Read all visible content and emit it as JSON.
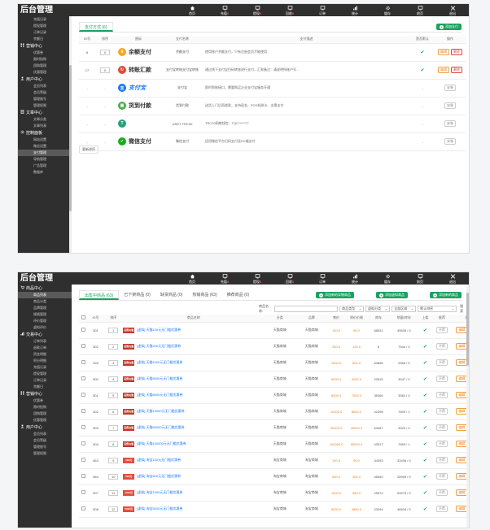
{
  "app_title": "后台管理",
  "nav": [
    {
      "label": "首页",
      "icon": "home-icon",
      "badge": ""
    },
    {
      "label": "充值",
      "icon": "monitor-icon",
      "badge": "0"
    },
    {
      "label": "提现",
      "icon": "monitor-icon",
      "badge": "0"
    },
    {
      "label": "回收",
      "icon": "monitor-icon",
      "badge": "0"
    },
    {
      "label": "订单",
      "icon": "monitor-icon",
      "badge": ""
    },
    {
      "label": "统计",
      "icon": "bar-chart-icon",
      "badge": ""
    },
    {
      "label": "缓存",
      "icon": "gear-icon",
      "badge": ""
    },
    {
      "label": "前页",
      "icon": "monitor-icon",
      "badge": ""
    },
    {
      "label": "退出",
      "icon": "close-icon",
      "badge": ""
    }
  ],
  "screen1": {
    "sidebar": [
      {
        "type": "item",
        "label": "充值记录"
      },
      {
        "type": "item",
        "label": "提现管理"
      },
      {
        "type": "item",
        "label": "订单记录"
      },
      {
        "type": "item",
        "label": "余额日"
      },
      {
        "type": "group",
        "label": "营销中心",
        "icon": "grid-icon"
      },
      {
        "type": "item",
        "label": "优惠券"
      },
      {
        "type": "item",
        "label": "限时抢购"
      },
      {
        "type": "item",
        "label": "团购管理"
      },
      {
        "type": "item",
        "label": "优惠管理"
      },
      {
        "type": "group",
        "label": "用户中心",
        "icon": "user-icon"
      },
      {
        "type": "item",
        "label": "会员列表"
      },
      {
        "type": "item",
        "label": "会员等级"
      },
      {
        "type": "item",
        "label": "管理账号"
      },
      {
        "type": "item",
        "label": "管理权限"
      },
      {
        "type": "group",
        "label": "文章中心",
        "icon": "doc-icon"
      },
      {
        "type": "item",
        "label": "文章分类"
      },
      {
        "type": "item",
        "label": "文章列表"
      },
      {
        "type": "group",
        "label": "控制面板",
        "icon": "gear-icon"
      },
      {
        "type": "item",
        "label": "网站设置"
      },
      {
        "type": "item",
        "label": "微信设置"
      },
      {
        "type": "item",
        "label": "支付管理",
        "active": true
      },
      {
        "type": "item",
        "label": "导航管理"
      },
      {
        "type": "item",
        "label": "广告管理"
      },
      {
        "type": "item",
        "label": "数据库"
      }
    ],
    "tab": "支付方式 (6)",
    "add_button": "添加支付",
    "headers": [
      "ID号",
      "排序",
      "图标",
      "支付名称",
      "支付描述",
      "是否默认",
      "操作"
    ],
    "rows": [
      {
        "id": "8",
        "sort": "0",
        "logo_color": "#f5a623",
        "logo_char": "¥",
        "name": "余额支付",
        "name_style": "",
        "pay_name": "余额支付",
        "desc": "使用账户余额支付，只有注册会员才能使用",
        "default": "✔",
        "ops": [
          "编辑",
          "删除"
        ],
        "op_style": "orange"
      },
      {
        "id": "17",
        "sort": "0",
        "logo_color": "#e04a3a",
        "logo_char": "↻",
        "name": "转账汇款",
        "name_style": "",
        "pay_name": "支付宝转账支付宝转账",
        "desc": "通过线下支付宝扫码转账进行支付，汇款备注：请说明所账户号…",
        "default": "✔",
        "ops": [
          "编辑",
          "删除"
        ],
        "op_style": "orange"
      },
      {
        "id": "-",
        "sort": "-",
        "logo_color": "#1677ff",
        "logo_char": "支",
        "name": "支付宝",
        "name_style": "alipay",
        "pay_name": "支付宝",
        "desc": "即时到账接口，需要购买企业支付宝服务开通",
        "default": "-",
        "ops": [
          "安装"
        ],
        "op_style": "grey"
      },
      {
        "id": "-",
        "sort": "-",
        "logo_color": "#4caf50",
        "logo_char": "▣",
        "name": "货到付款",
        "name_style": "",
        "pay_name": "货到付款",
        "desc": "送货上门后再收款，支持现金、POS机刷卡、支票支付",
        "default": "-",
        "ops": [
          "安装"
        ],
        "op_style": "grey"
      },
      {
        "id": "-",
        "sort": "-",
        "logo_color": "#26a17b",
        "logo_char": "T",
        "name": "",
        "name_style": "",
        "pay_name": "USDT-TRC20",
        "desc": "TRC20网络钱包：TQC*****T7",
        "default": "-",
        "ops": [
          "安装"
        ],
        "op_style": "grey"
      },
      {
        "id": "-",
        "sort": "-",
        "logo_color": "#1aad19",
        "logo_char": "✓",
        "name": "微信支付",
        "name_style": "",
        "pay_name": "微信支付",
        "desc": "适用微信平台扫码支付及PC端支付",
        "default": "-",
        "ops": [
          "安装"
        ],
        "op_style": "grey"
      }
    ],
    "sort_button": "更新排序"
  },
  "screen2": {
    "sidebar": [
      {
        "type": "group",
        "label": "商品中心",
        "icon": "cart-icon"
      },
      {
        "type": "item",
        "label": "商品列表",
        "active": true
      },
      {
        "type": "item",
        "label": "商品分类"
      },
      {
        "type": "item",
        "label": "品牌管理"
      },
      {
        "type": "item",
        "label": "规格管理"
      },
      {
        "type": "item",
        "label": "评价管理"
      },
      {
        "type": "item",
        "label": "虚拟评价"
      },
      {
        "type": "group",
        "label": "交易中心",
        "icon": "bar-chart-icon"
      },
      {
        "type": "item",
        "label": "订单列表"
      },
      {
        "type": "item",
        "label": "退款订单"
      },
      {
        "type": "item",
        "label": "资金明细"
      },
      {
        "type": "item",
        "label": "积分明细"
      },
      {
        "type": "item",
        "label": "充值记录"
      },
      {
        "type": "item",
        "label": "提现管理"
      },
      {
        "type": "item",
        "label": "订单记录"
      },
      {
        "type": "item",
        "label": "余额日"
      },
      {
        "type": "group",
        "label": "营销中心",
        "icon": "grid-icon"
      },
      {
        "type": "item",
        "label": "优惠券"
      },
      {
        "type": "item",
        "label": "限时抢购"
      },
      {
        "type": "item",
        "label": "团购管理"
      },
      {
        "type": "item",
        "label": "优惠管理"
      },
      {
        "type": "group",
        "label": "用户中心",
        "icon": "user-icon"
      },
      {
        "type": "item",
        "label": "会员列表"
      },
      {
        "type": "item",
        "label": "会员等级"
      },
      {
        "type": "item",
        "label": "管理账号"
      },
      {
        "type": "item",
        "label": "管理权限"
      }
    ],
    "tabs": [
      "出售中商品 (63)",
      "已下架商品 (0)",
      "缺货商品 (0)",
      "热销商品 (63)",
      "推荐商品 (0)"
    ],
    "action_buttons": [
      "添加新的实物商品",
      "添加虚拟商品",
      "添加新的商品"
    ],
    "filter": {
      "label": "商品名称:",
      "selects": [
        "商品类型",
        "虚拟分类",
        "全部区域",
        "默认排序"
      ],
      "search": "搜索"
    },
    "headers": [
      "",
      "ID号",
      "排序",
      "商品名称",
      "分类",
      "品牌",
      "售价",
      "原价价格",
      "库存",
      "销量/库存",
      "上架",
      "推荐",
      "操作"
    ],
    "rows": [
      {
        "id": "501",
        "sort": "1",
        "img_color": "#c0392b",
        "img_text": "话费充值",
        "name": "[虚拟] 天猫100元无门槛优惠券",
        "cat": "天猫商城",
        "brand": "天猫商城",
        "price": "100.0",
        "orig": "98.0",
        "stock": "68531",
        "sales": "45635 / 0"
      },
      {
        "id": "502",
        "sort": "2",
        "img_color": "#c0392b",
        "img_text": "话费充值",
        "name": "[虚拟] 天猫200元无门槛优惠券",
        "cat": "天猫商城",
        "brand": "天猫商城",
        "price": "300.0",
        "orig": "125.0",
        "stock": "6",
        "sales": "7544 / 0"
      },
      {
        "id": "499",
        "sort": "3",
        "img_color": "#c0392b",
        "img_text": "话费充值",
        "name": "[虚拟] 天猫1000元无门槛优惠券",
        "cat": "天猫商城",
        "brand": "天猫商城",
        "price": "1000.0",
        "orig": "600.0",
        "stock": "64896",
        "sales": "2565 / 0"
      },
      {
        "id": "500",
        "sort": "4",
        "img_color": "#c0392b",
        "img_text": "话费充值",
        "name": "[虚拟] 天猫5000元无门槛优惠券",
        "cat": "天猫商城",
        "brand": "天猫商城",
        "price": "5000.0",
        "orig": "4000.0",
        "stock": "23515",
        "sales": "3547 / 0"
      },
      {
        "id": "501",
        "sort": "5",
        "img_color": "#c0392b",
        "img_text": "话费充值",
        "name": "[虚拟] 天猫8000元无门槛优惠券",
        "cat": "天猫商城",
        "brand": "天猫商城",
        "price": "8000.0",
        "orig": "7500.0",
        "stock": "35366",
        "sales": "3563 / 0"
      },
      {
        "id": "502",
        "sort": "6",
        "img_color": "#c0392b",
        "img_text": "话费充值",
        "name": "[虚拟] 天猫10000元无门槛优惠券",
        "cat": "天猫商城",
        "brand": "天猫商城",
        "price": "10000.0",
        "orig": "8600.0",
        "stock": "42398",
        "sales": "7609 / 1"
      },
      {
        "id": "503",
        "sort": "7",
        "img_color": "#c0392b",
        "img_text": "话费充值",
        "name": "[虚拟] 天猫50000元无门槛优惠券",
        "cat": "天猫商城",
        "brand": "天猫商城",
        "price": "50000.0",
        "orig": "45000.0",
        "stock": "63457",
        "sales": "3520 / 0"
      },
      {
        "id": "504",
        "sort": "8",
        "img_color": "#c0392b",
        "img_text": "话费充值",
        "name": "[虚拟] 天猫100000元无门槛优惠券",
        "cat": "天猫商城",
        "brand": "天猫商城",
        "price": "100000.0",
        "orig": "95000.0",
        "stock": "43517",
        "sales": "7863 / 1"
      },
      {
        "id": "563",
        "sort": "9",
        "img_color": "#e74c3c",
        "img_text": "100元",
        "name": "[虚拟] 淘宝100元无门槛优惠券",
        "cat": "淘宝商城",
        "brand": "淘宝商城",
        "price": "100.0",
        "orig": "99.0",
        "stock": "34393",
        "sales": "33406 / 0"
      },
      {
        "id": "564",
        "sort": "10",
        "img_color": "#e74c3c",
        "img_text": "500元",
        "name": "[虚拟] 淘宝500元无门槛优惠券",
        "cat": "淘宝商城",
        "brand": "淘宝商城",
        "price": "500.0",
        "orig": "405.0",
        "stock": "45540",
        "sales": "28909 / 0"
      },
      {
        "id": "507",
        "sort": "11",
        "img_color": "#e74c3c",
        "img_text": "1000元",
        "name": "[虚拟] 淘宝1000元无门槛优惠券",
        "cat": "淘宝商城",
        "brand": "淘宝商城",
        "price": "1000.0",
        "orig": "960.0",
        "stock": "25574",
        "sales": "54579 / 0"
      },
      {
        "id": "508",
        "sort": "12",
        "img_color": "#e74c3c",
        "img_text": "5000元",
        "name": "[虚拟] 淘宝5000元无门槛优惠券",
        "cat": "淘宝商城",
        "brand": "淘宝商城",
        "price": "5000.0",
        "orig": "4850.0",
        "stock": "23294",
        "sales": "46634 / 0"
      }
    ],
    "row_ops": {
      "recommend": "不荐",
      "edit": "编辑",
      "delete": "删除",
      "check": "✔"
    }
  }
}
